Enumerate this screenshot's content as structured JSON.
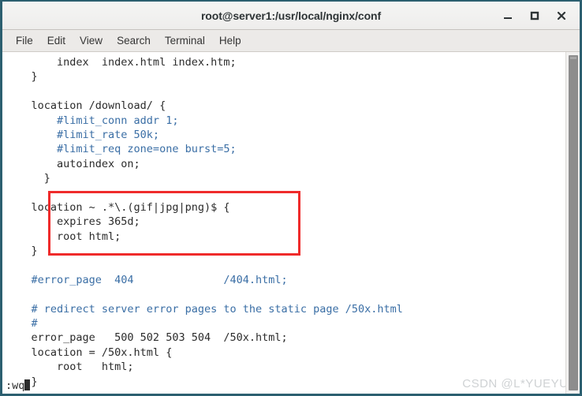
{
  "window": {
    "title": "root@server1:/usr/local/nginx/conf",
    "buttons": [
      {
        "name": "minimize",
        "label": "_"
      },
      {
        "name": "maximize",
        "label": "□"
      },
      {
        "name": "close",
        "label": "✕"
      }
    ]
  },
  "menubar": {
    "items": [
      {
        "label": "File"
      },
      {
        "label": "Edit"
      },
      {
        "label": "View"
      },
      {
        "label": "Search"
      },
      {
        "label": "Terminal"
      },
      {
        "label": "Help"
      }
    ]
  },
  "terminal": {
    "lines": [
      {
        "text": "        index  index.html index.htm;",
        "comment": false
      },
      {
        "text": "    }",
        "comment": false
      },
      {
        "text": "",
        "comment": false
      },
      {
        "text": "    location /download/ {",
        "comment": false
      },
      {
        "text": "        #limit_conn addr 1;",
        "comment": true
      },
      {
        "text": "        #limit_rate 50k;",
        "comment": true
      },
      {
        "text": "        #limit_req zone=one burst=5;",
        "comment": true
      },
      {
        "text": "        autoindex on;",
        "comment": false
      },
      {
        "text": "      }",
        "comment": false
      },
      {
        "text": "",
        "comment": false
      },
      {
        "text": "    location ~ .*\\.(gif|jpg|png)$ {",
        "comment": false
      },
      {
        "text": "        expires 365d;",
        "comment": false
      },
      {
        "text": "        root html;",
        "comment": false
      },
      {
        "text": "    }",
        "comment": false
      },
      {
        "text": "",
        "comment": false
      },
      {
        "text": "    #error_page  404              /404.html;",
        "comment": true
      },
      {
        "text": "",
        "comment": false
      },
      {
        "text": "    # redirect server error pages to the static page /50x.html",
        "comment": true
      },
      {
        "text": "    #",
        "comment": true
      },
      {
        "text": "    error_page   500 502 503 504  /50x.html;",
        "comment": false
      },
      {
        "text": "    location = /50x.html {",
        "comment": false
      },
      {
        "text": "        root   html;",
        "comment": false
      },
      {
        "text": "    }",
        "comment": false
      }
    ],
    "status_command": ":wq"
  },
  "annotation": {
    "type": "red-rectangle",
    "color": "#ef2b2b",
    "highlights": "location ~ .*\\.(gif|jpg|png)$ { expires 365d; root html; }"
  },
  "watermark": {
    "text": "CSDN @L*YUEYUE"
  },
  "colors": {
    "window_border": "#2c5f70",
    "titlebar": "#f2f1f0",
    "terminal_bg": "#ffffff",
    "terminal_fg": "#2b2b2b",
    "comment_blue": "#3a6ea5",
    "annotation_red": "#ef2b2b",
    "watermark_gray": "#cfd2d4",
    "scrollbar_thumb": "#8d8d8d"
  }
}
